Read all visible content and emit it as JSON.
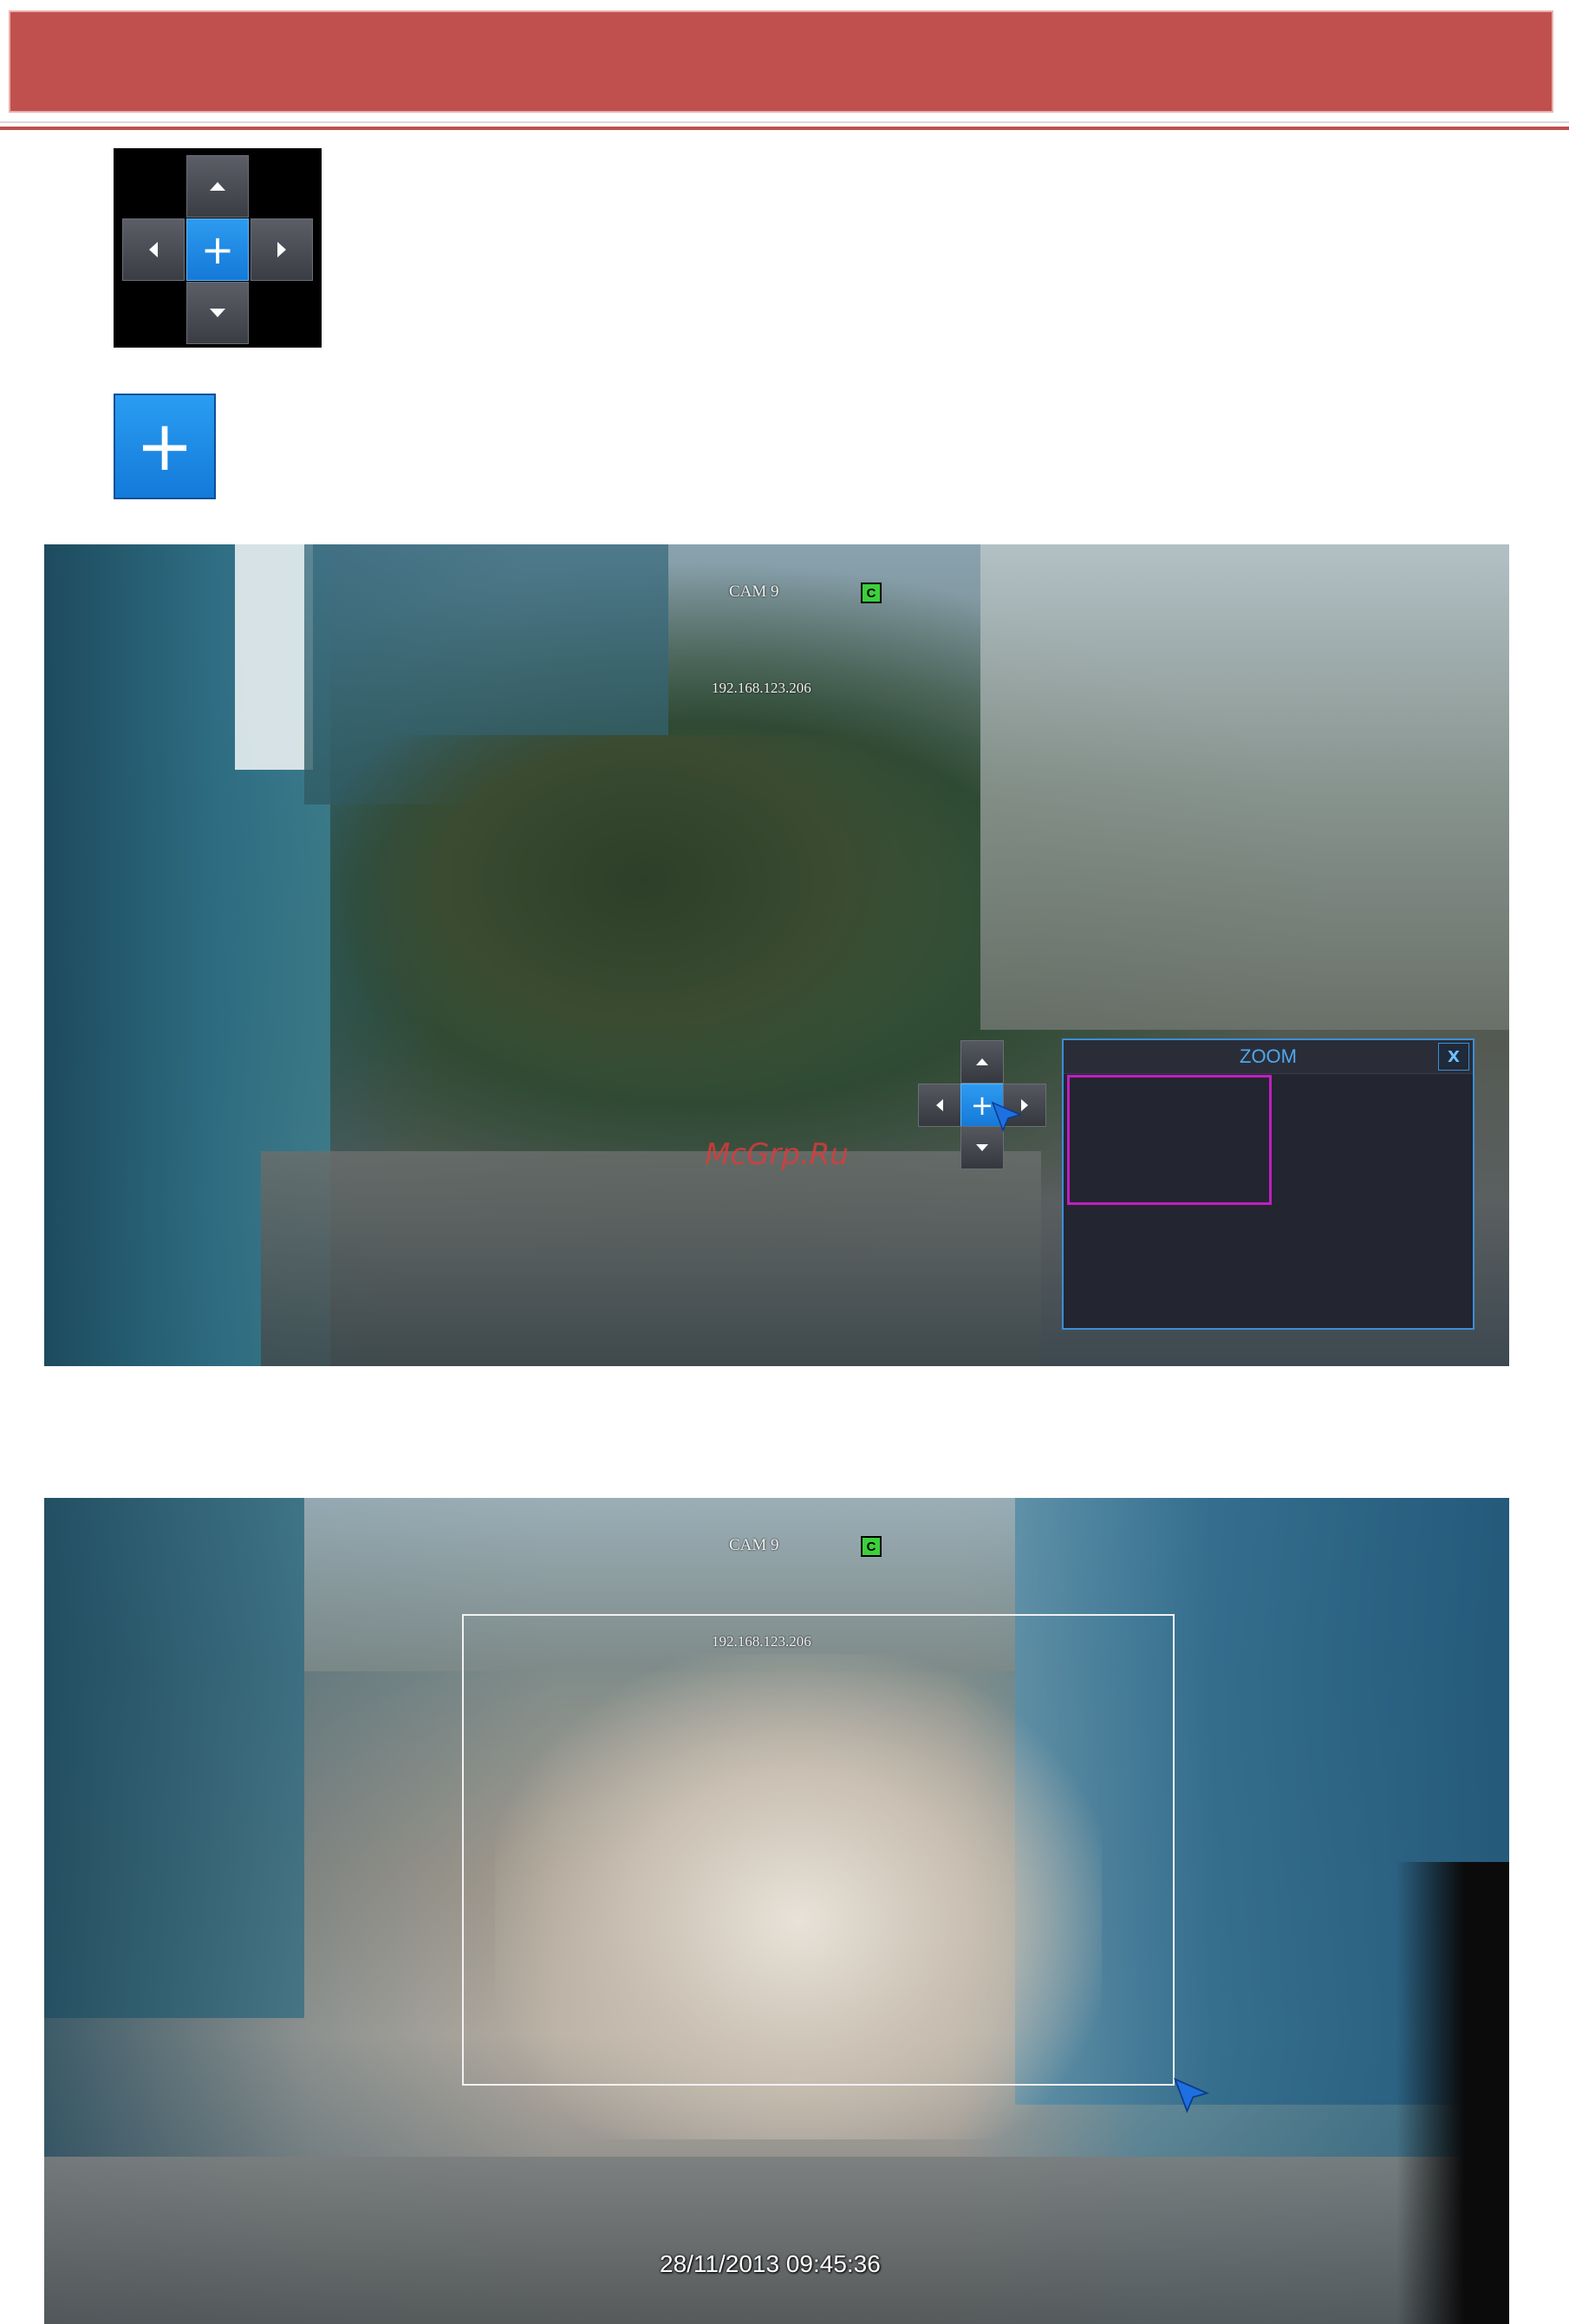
{
  "colors": {
    "header": "#c0504d",
    "ptz_accent": "#1e88e5",
    "zoom_selection": "#c21ec2",
    "zoom_border": "#3a8fd8",
    "cam_badge": "#3cd03c"
  },
  "ptz_panel": {
    "up_icon": "arrow-up-icon",
    "down_icon": "arrow-down-icon",
    "left_icon": "arrow-left-icon",
    "right_icon": "arrow-right-icon",
    "center_label": "+"
  },
  "zoom_button": {
    "label": "+"
  },
  "camera_view_1": {
    "camera_name": "CAM 9",
    "record_badge": "C",
    "ip_address": "192.168.123.206",
    "ptz_center_label": "+",
    "zoom_window": {
      "title": "ZOOM",
      "close_label": "X"
    },
    "watermark": "McGrp.Ru"
  },
  "camera_view_2": {
    "camera_name": "CAM 9",
    "record_badge": "C",
    "ip_address": "192.168.123.206",
    "timestamp": "28/11/2013 09:45:36"
  }
}
